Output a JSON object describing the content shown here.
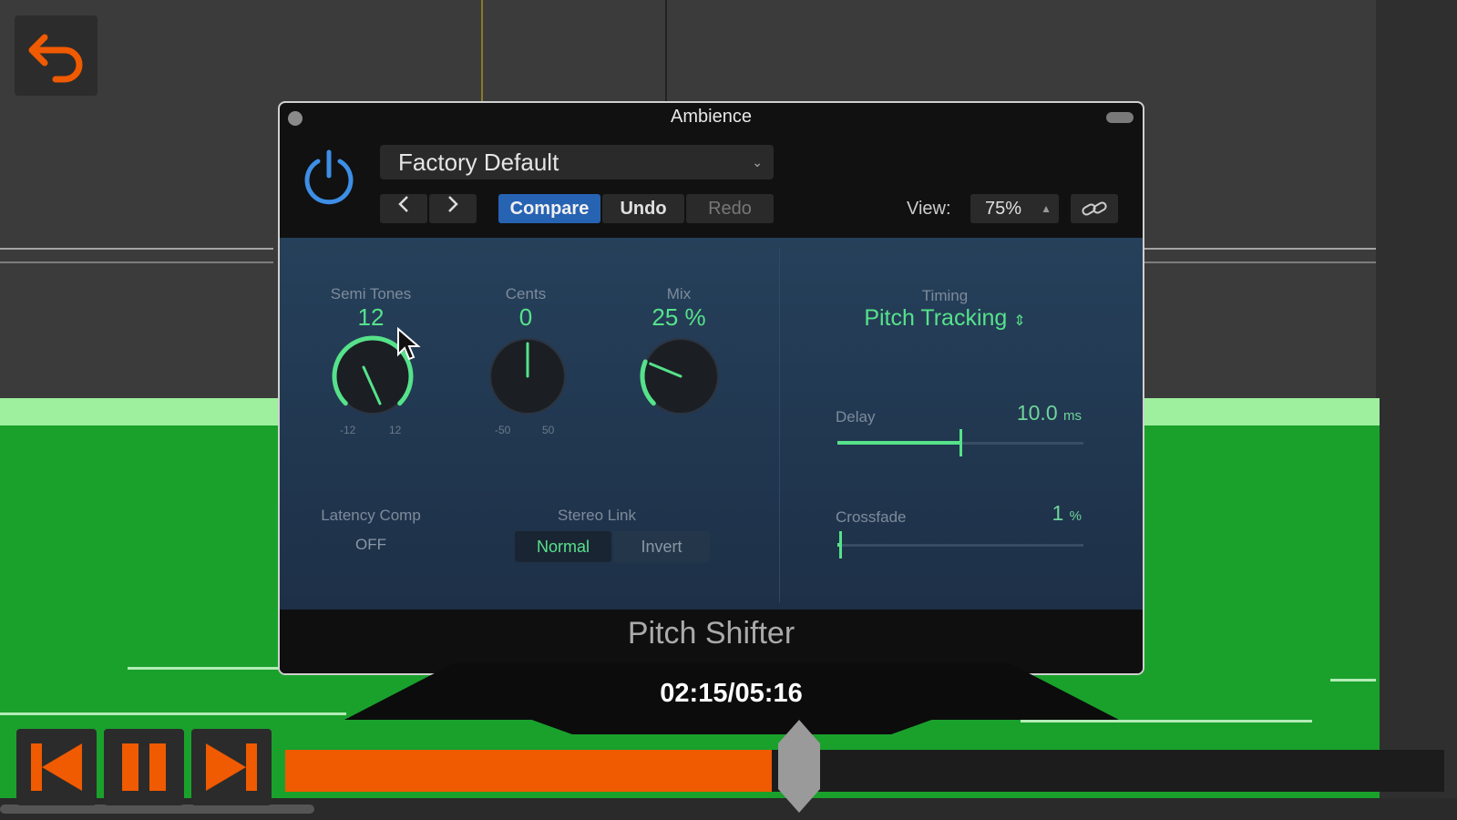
{
  "plugin": {
    "title": "Ambience",
    "preset": "Factory Default",
    "toolbar": {
      "prev_icon": "chevron-left-icon",
      "next_icon": "chevron-right-icon",
      "compare_label": "Compare",
      "undo_label": "Undo",
      "redo_label": "Redo",
      "view_label": "View:",
      "view_value": "75%",
      "link_icon": "link-icon"
    },
    "knobs": [
      {
        "label": "Semi Tones",
        "value": "12",
        "min_label": "-12",
        "max_label": "12",
        "value_fraction": 1.0
      },
      {
        "label": "Cents",
        "value": "0",
        "min_label": "-50",
        "max_label": "50",
        "value_fraction": 0.5
      },
      {
        "label": "Mix",
        "value": "25 %",
        "min_label": "",
        "max_label": "",
        "value_fraction": 0.25
      }
    ],
    "timing": {
      "label": "Timing",
      "value": "Pitch Tracking"
    },
    "delay": {
      "label": "Delay",
      "value": "10.0",
      "unit": "ms",
      "fraction": 0.5
    },
    "crossfade": {
      "label": "Crossfade",
      "value": "1",
      "unit": "%",
      "fraction": 0.01
    },
    "latency_comp": {
      "label": "Latency Comp",
      "value": "OFF"
    },
    "stereo_link": {
      "label": "Stereo Link",
      "options": [
        "Normal",
        "Invert"
      ],
      "selected": "Normal"
    },
    "plugin_name": "Pitch Shifter"
  },
  "player": {
    "time": "02:15/05:16",
    "progress": 0.42,
    "accent": "#f05a00",
    "back_icon": "undo-arrow-icon",
    "prev_icon": "skip-back-icon",
    "pause_icon": "pause-icon",
    "next_icon": "skip-forward-icon"
  },
  "colors": {
    "value_green": "#56e28a",
    "compare_blue": "#2763b3",
    "track_green": "#1aa12c"
  }
}
